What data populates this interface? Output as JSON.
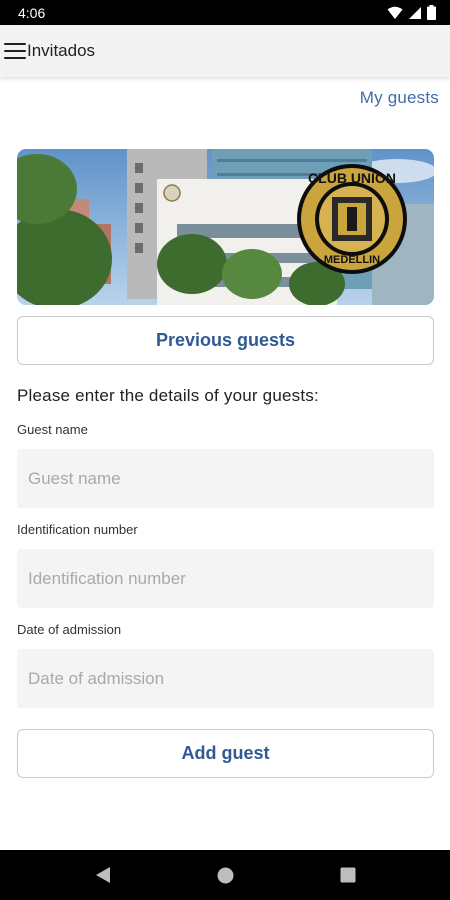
{
  "status_bar": {
    "time": "4:06"
  },
  "app_bar": {
    "title": "Invitados"
  },
  "header_link": {
    "label": "My guests"
  },
  "banner": {
    "logo_top_text": "CLUB UNION",
    "logo_bottom_text": "MEDELLIN"
  },
  "buttons": {
    "previous_label": "Previous guests",
    "add_label": "Add guest"
  },
  "form": {
    "instructions": "Please enter the details of your guests:",
    "guest_name": {
      "label": "Guest name",
      "placeholder": "Guest name"
    },
    "identification": {
      "label": "Identification number",
      "placeholder": "Identification number"
    },
    "date": {
      "label": "Date of admission",
      "placeholder": "Date of admission"
    }
  },
  "colors": {
    "accent": "#2f5a93",
    "link": "#3f6ea8",
    "field_bg": "#f4f4f4",
    "app_bar_bg": "#f3f3f3"
  }
}
